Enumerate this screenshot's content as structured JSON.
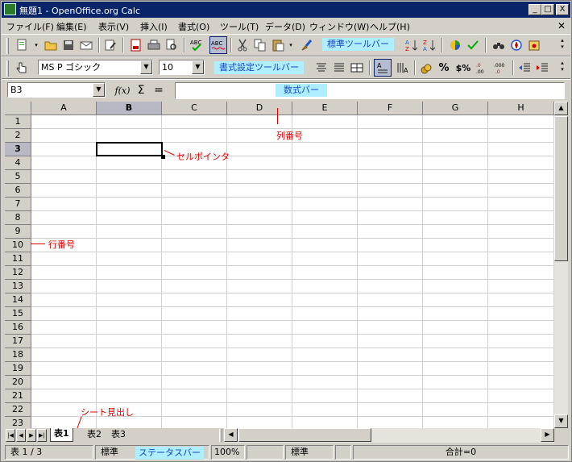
{
  "window": {
    "title": "無題1 - OpenOffice.org Calc",
    "minimize": "_",
    "maximize": "□",
    "close": "X",
    "doc_close": "✕"
  },
  "menu": [
    "ファイル(F)",
    "編集(E)",
    "表示(V)",
    "挿入(I)",
    "書式(O)",
    "ツール(T)",
    "データ(D)",
    "ウィンドウ(W)",
    "ヘルプ(H)"
  ],
  "toolbar_standard": {
    "label": "標準ツールバー"
  },
  "toolbar_format": {
    "font_name": "MS P ゴシック",
    "font_size": "10",
    "label": "書式設定ツールバー",
    "percent": "%",
    "currency": "$%"
  },
  "formula_bar": {
    "name_box": "B3",
    "fx": "f(x)",
    "sigma": "Σ",
    "equals": "=",
    "label": "数式バー"
  },
  "grid": {
    "columns": [
      "A",
      "B",
      "C",
      "D",
      "E",
      "F",
      "G",
      "H"
    ],
    "rows": [
      "1",
      "2",
      "3",
      "4",
      "5",
      "6",
      "7",
      "8",
      "9",
      "10",
      "11",
      "12",
      "13",
      "14",
      "15",
      "16",
      "17",
      "18",
      "19",
      "20",
      "21",
      "22",
      "23"
    ],
    "selected_column": "B",
    "selected_row": "3"
  },
  "annotations": {
    "column_header": "列番号",
    "cell_pointer": "セルポインタ",
    "row_header": "行番号",
    "sheet_tabs": "シート見出し",
    "status_bar": "ステータスバー"
  },
  "sheets": [
    "表1",
    "表2",
    "表3"
  ],
  "active_sheet": "表1",
  "status": {
    "page": "表 1 / 3",
    "style": "標準",
    "zoom": "100%",
    "mode": "標準",
    "sum": "合計=0"
  },
  "colors": {
    "title_bar": "#0a246a",
    "note_bg": "#aeeeff",
    "note_text": "#1a46c8",
    "annotation": "#e00000",
    "selected_header": "#b9b9c5"
  }
}
